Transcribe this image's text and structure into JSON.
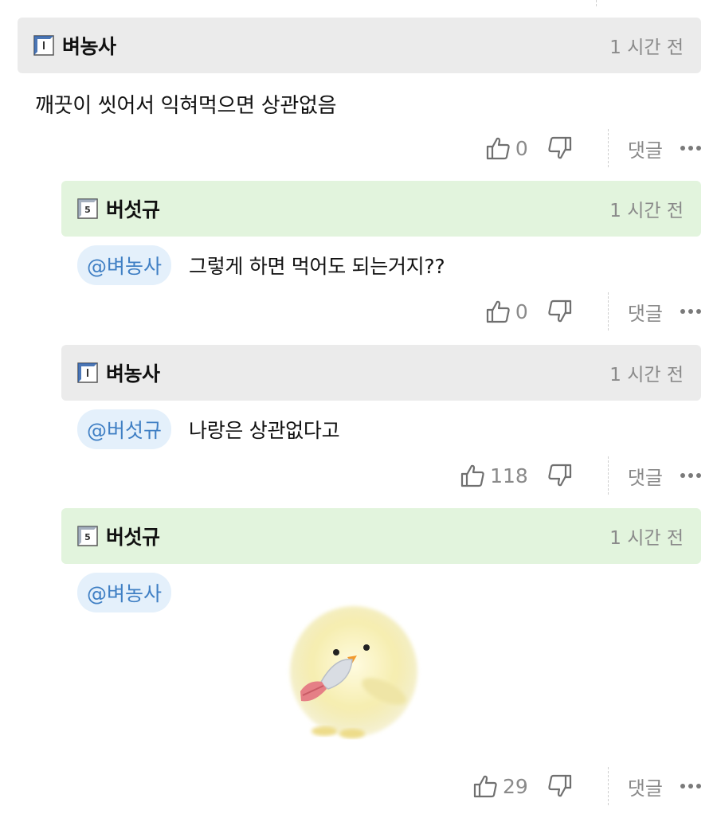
{
  "comments": [
    {
      "author": "벼농사",
      "time": "1 시간 전",
      "mention": "",
      "text": "깨끗이 씻어서 익혀먹으면 상관없음",
      "likes": "0",
      "reply_label": "댓글",
      "header_color": "#ebebeb",
      "level_icon": "level-i-icon"
    },
    {
      "author": "버섯규",
      "time": "1 시간 전",
      "mention": "@벼농사",
      "text": "그렇게 하면 먹어도 되는거지??",
      "likes": "0",
      "reply_label": "댓글",
      "header_color": "#e2f4dd",
      "level_icon": "level-5-icon"
    },
    {
      "author": "벼농사",
      "time": "1 시간 전",
      "mention": "@버섯규",
      "text": "나랑은 상관없다고",
      "likes": "118",
      "reply_label": "댓글",
      "header_color": "#ebebeb",
      "level_icon": "level-i-icon"
    },
    {
      "author": "버섯규",
      "time": "1 시간 전",
      "mention": "@벼농사",
      "text": "",
      "likes": "29",
      "reply_label": "댓글",
      "header_color": "#e2f4dd",
      "level_icon": "level-5-icon",
      "image": "chick-with-knife-sticker"
    }
  ]
}
